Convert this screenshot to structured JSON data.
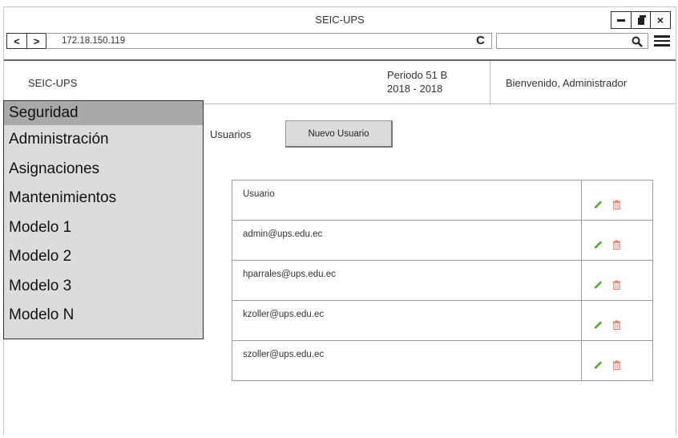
{
  "window": {
    "title": "SEIC-UPS",
    "controls": {
      "minimize": "–",
      "maximize": "",
      "close": "×"
    }
  },
  "browser": {
    "back": "<",
    "forward": ">",
    "url": "172.18.150.119",
    "reload": "C",
    "search_value": ""
  },
  "header": {
    "brand": "SEIC-UPS",
    "period_line1": "Periodo 51 B",
    "period_line2": "2018 - 2018",
    "welcome": "Bienvenido, Administrador"
  },
  "sidebar": {
    "items": [
      {
        "label": "Seguridad",
        "active": true
      },
      {
        "label": "Administración",
        "active": false
      },
      {
        "label": "Asignaciones",
        "active": false
      },
      {
        "label": "Mantenimientos",
        "active": false
      },
      {
        "label": "Modelo 1",
        "active": false
      },
      {
        "label": "Modelo 2",
        "active": false
      },
      {
        "label": "Modelo 3",
        "active": false
      },
      {
        "label": "Modelo N",
        "active": false
      }
    ]
  },
  "main": {
    "section_label": "Usuarios",
    "new_user_label": "Nuevo Usuario",
    "table": {
      "header": "Usuario",
      "rows": [
        "admin@ups.edu.ec",
        "hparrales@ups.edu.ec",
        "kzoller@ups.edu.ec",
        "szoller@ups.edu.ec"
      ]
    }
  },
  "icons": {
    "edit": "pencil-icon",
    "delete": "trash-icon",
    "edit_color": "#5aa83a",
    "delete_color": "#e07a6a"
  }
}
